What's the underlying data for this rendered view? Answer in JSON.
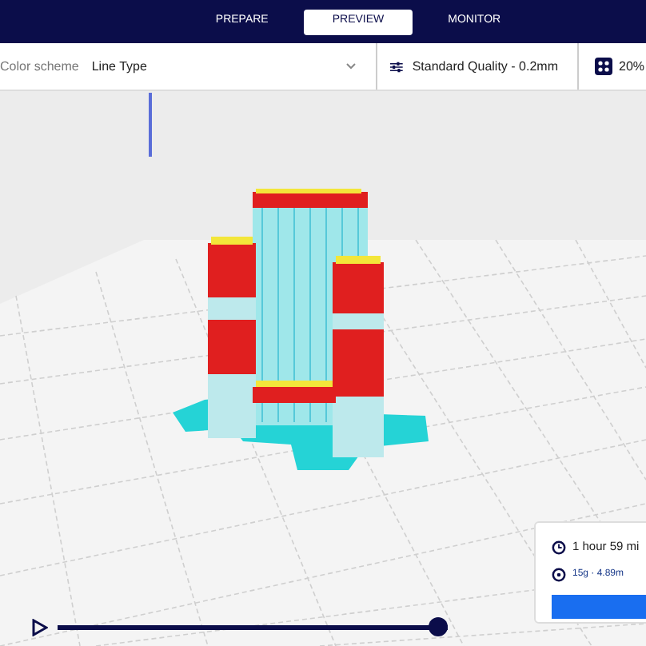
{
  "stage_tabs": [
    {
      "label": "PREPARE",
      "selected": false
    },
    {
      "label": "PREVIEW",
      "selected": true
    },
    {
      "label": "MONITOR",
      "selected": false
    }
  ],
  "view_bar": {
    "color_scheme_label": "Color scheme",
    "color_scheme_value": "Line Type",
    "profile": "Standard Quality - 0.2mm",
    "infill": "20%"
  },
  "simulation": {
    "level": 1
  },
  "print_info": {
    "time": "1 hour 59 mi",
    "material": "15g · 4.89m"
  }
}
